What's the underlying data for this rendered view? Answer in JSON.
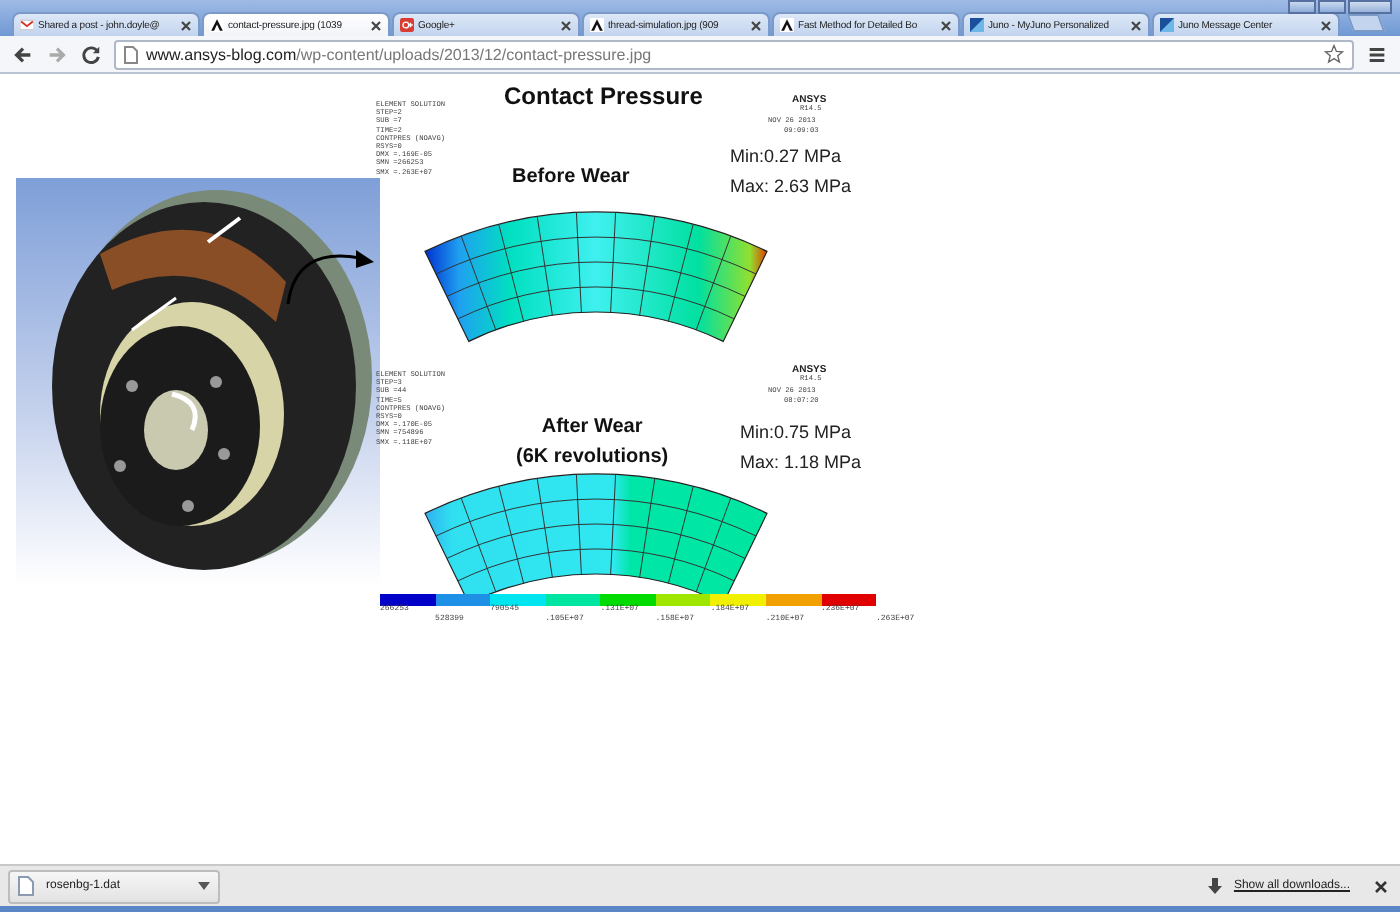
{
  "tabs": [
    {
      "title": "Shared a post - john.doyle@",
      "kind": "mail",
      "selected": false
    },
    {
      "title": "contact-pressure.jpg (1039",
      "kind": "ansys",
      "selected": true
    },
    {
      "title": "Google+",
      "kind": "gplus",
      "selected": false
    },
    {
      "title": "thread-simulation.jpg (909",
      "kind": "ansys",
      "selected": false
    },
    {
      "title": "Fast Method for Detailed Bo",
      "kind": "ansys",
      "selected": false
    },
    {
      "title": "Juno - MyJuno Personalized",
      "kind": "juno",
      "selected": false
    },
    {
      "title": "Juno Message Center",
      "kind": "juno",
      "selected": false
    }
  ],
  "address_bar": {
    "host": "www.ansys-blog.com",
    "path": "/wp-content/uploads/2013/12/contact-pressure.jpg"
  },
  "image": {
    "title": "Contact Pressure",
    "plots": [
      {
        "solution_lines": [
          "ELEMENT SOLUTION",
          "STEP=2",
          "SUB =7",
          "TIME=2",
          "CONTPRES (NOAVG)",
          "RSYS=0",
          "DMX =.169E-05",
          "SMN =266253",
          "SMX =.263E+07"
        ],
        "logo": "ANSYS",
        "version": "R14.5",
        "date": "NOV 26 2013",
        "time": "09:09:03",
        "caption": [
          "Before Wear"
        ],
        "min": "Min:0.27 MPa",
        "max": "Max: 2.63 MPa"
      },
      {
        "solution_lines": [
          "ELEMENT SOLUTION",
          "STEP=3",
          "SUB =44",
          "TIME=5",
          "CONTPRES (NOAVG)",
          "RSYS=0",
          "DMX =.170E-05",
          "SMN =754896",
          "SMX =.118E+07"
        ],
        "logo": "ANSYS",
        "version": "R14.5",
        "date": "NOV 26 2013",
        "time": "08:07:20",
        "caption": [
          "After Wear",
          "(6K revolutions)"
        ],
        "min": "Min:0.75 MPa",
        "max": "Max: 1.18 MPa"
      }
    ],
    "legend": {
      "bands": [
        {
          "color": "#0000c8"
        },
        {
          "color": "#1e90e6"
        },
        {
          "color": "#00e6f0"
        },
        {
          "color": "#00e6a0"
        },
        {
          "color": "#00dc00"
        },
        {
          "color": "#9ee600"
        },
        {
          "color": "#f0f000"
        },
        {
          "color": "#f0a000"
        },
        {
          "color": "#e00000"
        }
      ],
      "ticks": [
        "266253",
        "528399",
        "790545",
        ".105E+07",
        ".131E+07",
        ".158E+07",
        ".184E+07",
        ".210E+07",
        ".236E+07",
        ".263E+07"
      ]
    }
  },
  "downloads": {
    "file": "rosenbg-1.dat",
    "show_all": "Show all downloads..."
  }
}
